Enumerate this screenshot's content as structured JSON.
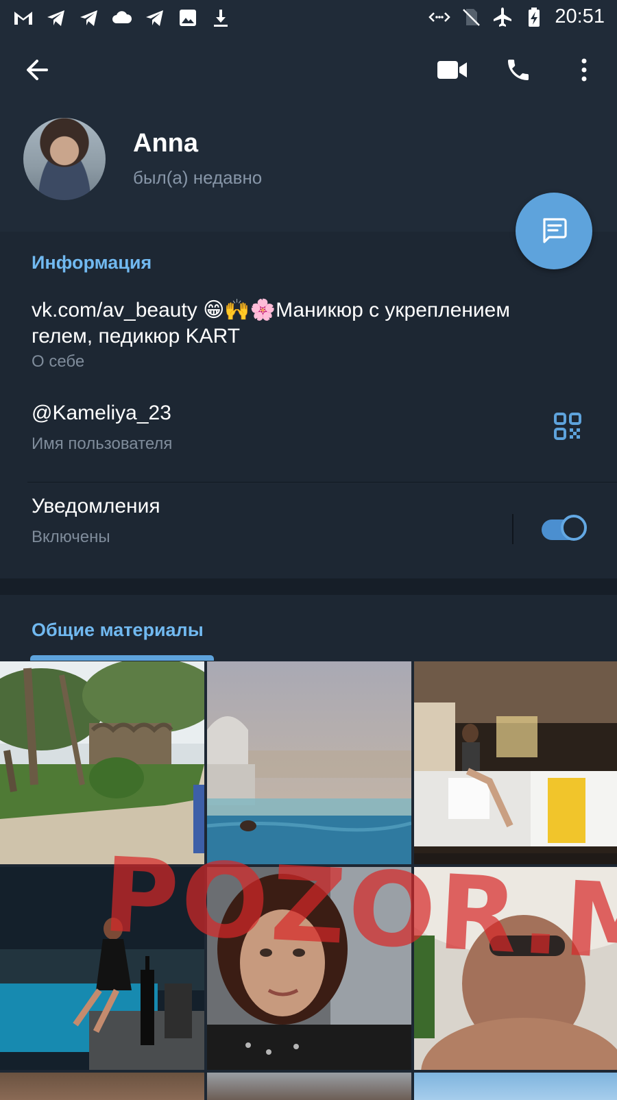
{
  "status_bar": {
    "time": "20:51",
    "left_icons": [
      "gmail-icon",
      "telegram-icon",
      "telegram-icon",
      "cloud-icon",
      "telegram-icon",
      "image-icon",
      "download-icon"
    ],
    "right_icons": [
      "nfc-icon",
      "no-sim-icon",
      "airplane-icon",
      "battery-charging-icon"
    ]
  },
  "header": {
    "back_icon": "arrow-left-icon",
    "actions": [
      "video-call-icon",
      "phone-call-icon",
      "more-vertical-icon"
    ],
    "name": "Anna",
    "last_seen": "был(а) недавно"
  },
  "fab": {
    "icon": "message-icon"
  },
  "info": {
    "title": "Информация",
    "bio_line1": "vk.com/av_beauty 😁🙌🌸Маникюр с укреплением",
    "bio_line2": "гелем, педикюр KART",
    "bio_caption": "О себе",
    "username": "@Kameliya_23",
    "username_caption": "Имя пользователя",
    "notifications_label": "Уведомления",
    "notifications_state": "Включены",
    "notifications_on": true
  },
  "shared": {
    "title": "Общие материалы",
    "tiles": [
      {
        "desc": "park-trees"
      },
      {
        "desc": "infinity-pool-city"
      },
      {
        "desc": "hotel-lobby"
      },
      {
        "desc": "night-pool"
      },
      {
        "desc": "selfie"
      },
      {
        "desc": "sun-hat"
      }
    ]
  },
  "watermark": "POZOR.ME",
  "colors": {
    "background": "#1d2733",
    "header": "#202b38",
    "accent": "#5ea3dc",
    "section_title": "#71b9f0",
    "secondary_text": "#7f8c9b"
  }
}
